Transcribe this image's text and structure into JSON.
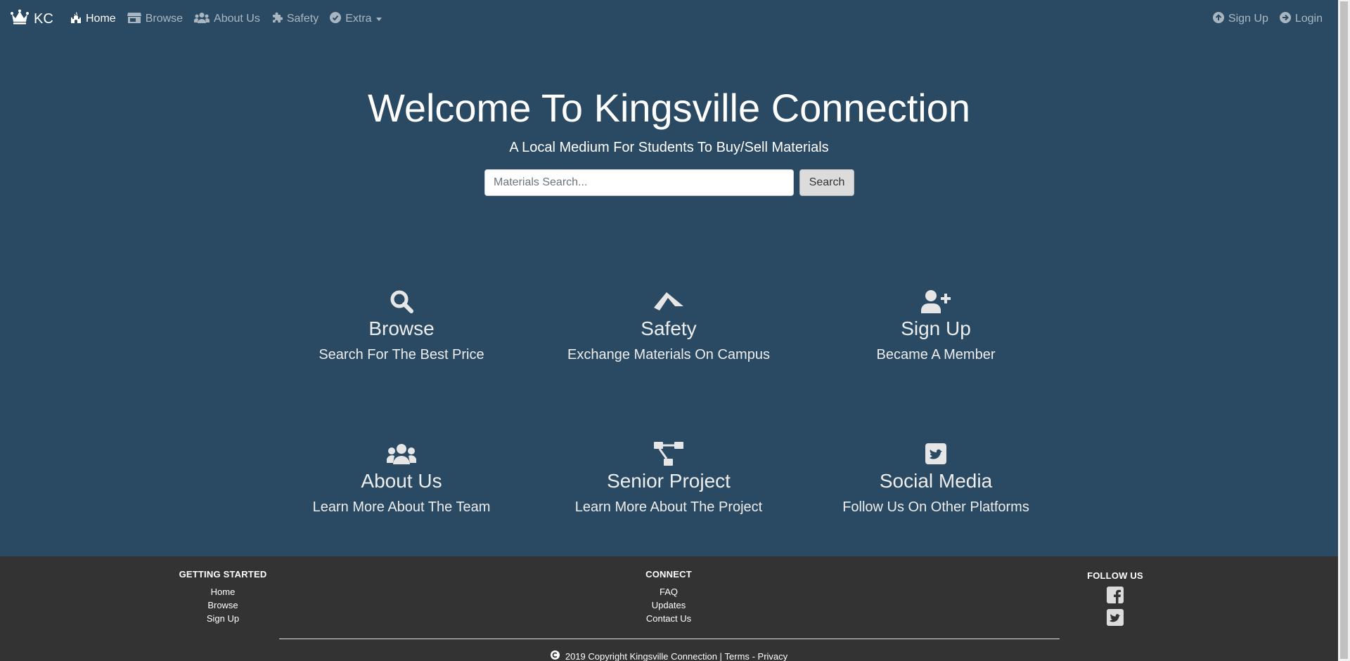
{
  "navbar": {
    "brand": "KC",
    "left_items": [
      {
        "label": "Home",
        "icon": "castle-icon",
        "active": true
      },
      {
        "label": "Browse",
        "icon": "store-icon",
        "active": false
      },
      {
        "label": "About Us",
        "icon": "users-icon",
        "active": false
      },
      {
        "label": "Safety",
        "icon": "puzzle-icon",
        "active": false
      },
      {
        "label": "Extra",
        "icon": "check-circle-icon",
        "active": false,
        "dropdown": true
      }
    ],
    "right_items": [
      {
        "label": "Sign Up",
        "icon": "arrow-up-circle-icon"
      },
      {
        "label": "Login",
        "icon": "arrow-right-circle-icon"
      }
    ]
  },
  "hero": {
    "title": "Welcome To Kingsville Connection",
    "subtitle": "A Local Medium For Students To Buy/Sell Materials",
    "search_placeholder": "Materials Search...",
    "search_value": "",
    "search_button": "Search"
  },
  "features": [
    {
      "title": "Browse",
      "desc": "Search For The Best Price",
      "icon": "search-icon"
    },
    {
      "title": "Safety",
      "desc": "Exchange Materials On Campus",
      "icon": "paper-plane-icon"
    },
    {
      "title": "Sign Up",
      "desc": "Became A Member",
      "icon": "user-plus-icon"
    },
    {
      "title": "About Us",
      "desc": "Learn More About The Team",
      "icon": "users-icon"
    },
    {
      "title": "Senior Project",
      "desc": "Learn More About The Project",
      "icon": "project-diagram-icon"
    },
    {
      "title": "Social Media",
      "desc": "Follow Us On Other Platforms",
      "icon": "twitter-square-icon"
    }
  ],
  "footer": {
    "getting_started": {
      "heading": "GETTING STARTED",
      "links": [
        "Home",
        "Browse",
        "Sign Up"
      ]
    },
    "connect": {
      "heading": "CONNECT",
      "links": [
        "FAQ",
        "Updates",
        "Contact Us"
      ]
    },
    "follow": {
      "heading": "FOLLOW US",
      "icons": [
        "facebook-square-icon",
        "twitter-square-icon"
      ]
    },
    "copyright": "2019 Copyright Kingsville Connection |",
    "terms": "Terms",
    "separator": "-",
    "privacy": "Privacy"
  },
  "colors": {
    "background": "#2a4a63",
    "footer": "#333333",
    "text": "#ffffff"
  }
}
